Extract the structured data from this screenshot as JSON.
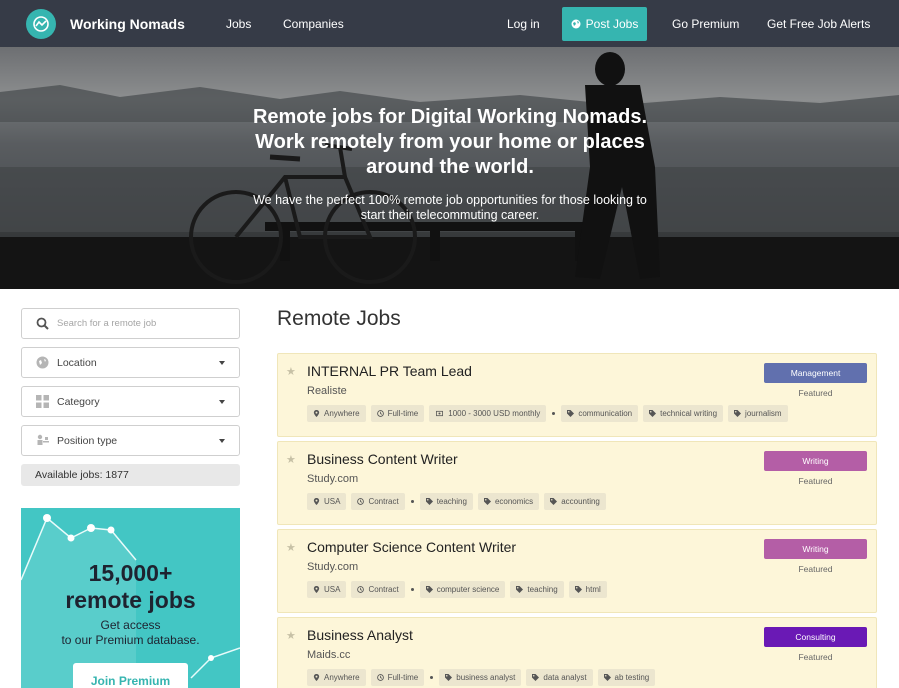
{
  "nav": {
    "brand": "Working Nomads",
    "links": {
      "jobs": "Jobs",
      "companies": "Companies",
      "login": "Log in",
      "post_jobs": "Post Jobs",
      "premium": "Go Premium",
      "alerts": "Get Free Job Alerts"
    }
  },
  "hero": {
    "title_lines": [
      "Remote jobs for Digital Working Nomads.",
      "Work remotely from your home or places",
      "around the world."
    ],
    "sub_lines": [
      "We have the perfect 100% remote job opportunities for those looking to",
      "start their telecommuting career."
    ]
  },
  "sidebar": {
    "search_placeholder": "Search for a remote job",
    "location": "Location",
    "category": "Category",
    "position_type": "Position type",
    "available": "Available jobs: 1877",
    "promo": {
      "big_1": "15,000+",
      "big_2": "remote jobs",
      "small_1": "Get access",
      "small_2": "to our Premium database.",
      "button": "Join Premium"
    }
  },
  "main": {
    "title": "Remote Jobs",
    "featured_label": "Featured",
    "jobs": [
      {
        "title": "INTERNAL PR Team Lead",
        "company": "Realiste",
        "category": "Management",
        "badge_color": "#6170ae",
        "meta": [
          "Anywhere",
          "Full-time",
          "1000 - 3000 USD monthly"
        ],
        "tags": [
          "communication",
          "technical writing",
          "journalism"
        ]
      },
      {
        "title": "Business Content Writer",
        "company": "Study.com",
        "category": "Writing",
        "badge_color": "#b45ea6",
        "meta": [
          "USA",
          "Contract"
        ],
        "tags": [
          "teaching",
          "economics",
          "accounting"
        ]
      },
      {
        "title": "Computer Science Content Writer",
        "company": "Study.com",
        "category": "Writing",
        "badge_color": "#b45ea6",
        "meta": [
          "USA",
          "Contract"
        ],
        "tags": [
          "computer science",
          "teaching",
          "html"
        ]
      },
      {
        "title": "Business Analyst",
        "company": "Maids.cc",
        "category": "Consulting",
        "badge_color": "#6a19b5",
        "meta": [
          "Anywhere",
          "Full-time"
        ],
        "tags": [
          "business analyst",
          "data analyst",
          "ab testing"
        ]
      }
    ]
  },
  "colors": {
    "nav_bg": "#363b47",
    "accent": "#36b5b0",
    "card_bg": "#fdf6d9",
    "promo_bg": "#43c6c4"
  }
}
